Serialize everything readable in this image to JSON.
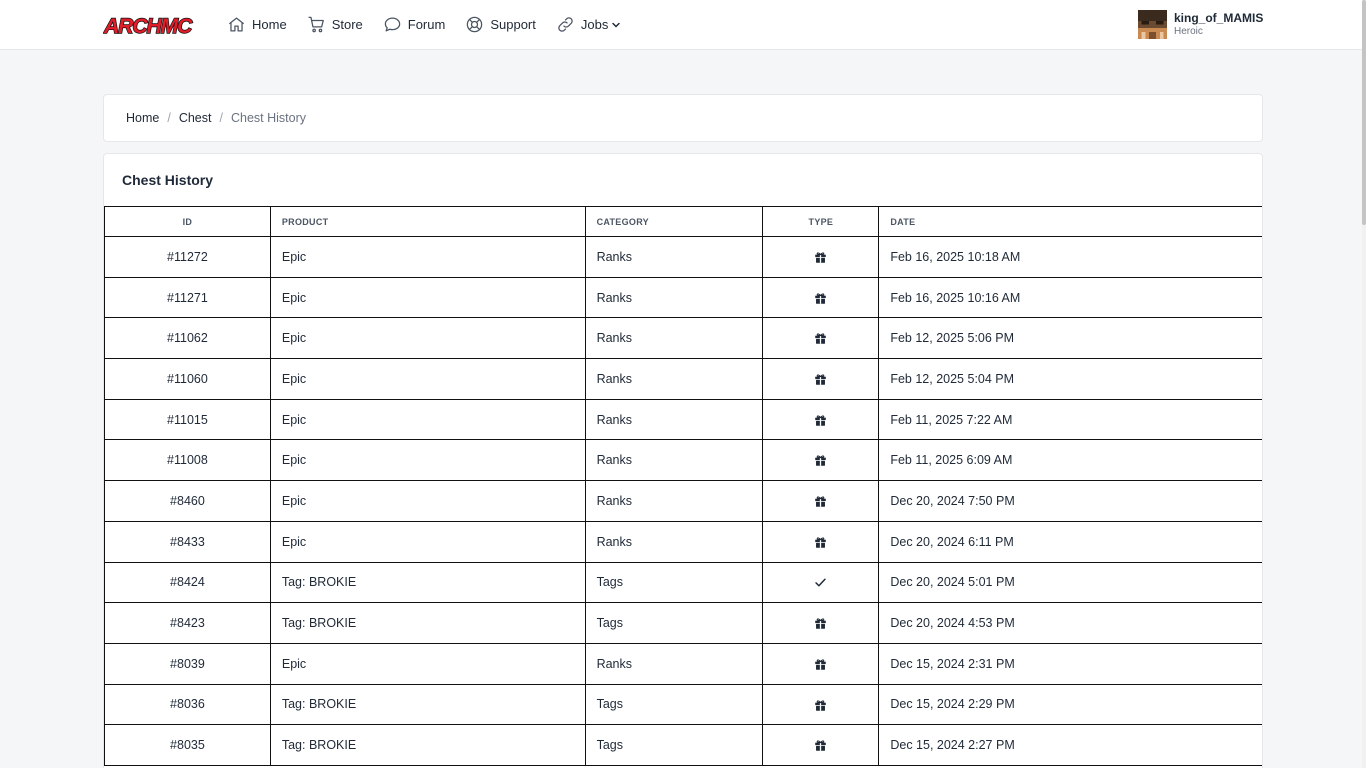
{
  "nav": {
    "logo_text": "ARCHMC",
    "items": [
      {
        "label": "Home",
        "icon": "home-icon"
      },
      {
        "label": "Store",
        "icon": "cart-icon"
      },
      {
        "label": "Forum",
        "icon": "chat-icon"
      },
      {
        "label": "Support",
        "icon": "lifebuoy-icon"
      },
      {
        "label": "Jobs",
        "icon": "link-icon"
      }
    ]
  },
  "user": {
    "name": "king_of_MAMIS",
    "rank": "Heroic"
  },
  "breadcrumb": {
    "home": "Home",
    "chest": "Chest",
    "current": "Chest History"
  },
  "card": {
    "title": "Chest History"
  },
  "table": {
    "headers": {
      "id": "ID",
      "product": "PRODUCT",
      "category": "CATEGORY",
      "type": "TYPE",
      "date": "DATE"
    },
    "rows": [
      {
        "id": "#11272",
        "product": "Epic",
        "category": "Ranks",
        "type": "gift-icon",
        "date": "Feb 16, 2025 10:18 AM"
      },
      {
        "id": "#11271",
        "product": "Epic",
        "category": "Ranks",
        "type": "gift-icon",
        "date": "Feb 16, 2025 10:16 AM"
      },
      {
        "id": "#11062",
        "product": "Epic",
        "category": "Ranks",
        "type": "gift-icon",
        "date": "Feb 12, 2025 5:06 PM"
      },
      {
        "id": "#11060",
        "product": "Epic",
        "category": "Ranks",
        "type": "gift-icon",
        "date": "Feb 12, 2025 5:04 PM"
      },
      {
        "id": "#11015",
        "product": "Epic",
        "category": "Ranks",
        "type": "gift-icon",
        "date": "Feb 11, 2025 7:22 AM"
      },
      {
        "id": "#11008",
        "product": "Epic",
        "category": "Ranks",
        "type": "gift-icon",
        "date": "Feb 11, 2025 6:09 AM"
      },
      {
        "id": "#8460",
        "product": "Epic",
        "category": "Ranks",
        "type": "gift-icon",
        "date": "Dec 20, 2024 7:50 PM"
      },
      {
        "id": "#8433",
        "product": "Epic",
        "category": "Ranks",
        "type": "gift-icon",
        "date": "Dec 20, 2024 6:11 PM"
      },
      {
        "id": "#8424",
        "product": "Tag: BROKIE",
        "category": "Tags",
        "type": "check-icon",
        "date": "Dec 20, 2024 5:01 PM"
      },
      {
        "id": "#8423",
        "product": "Tag: BROKIE",
        "category": "Tags",
        "type": "gift-icon",
        "date": "Dec 20, 2024 4:53 PM"
      },
      {
        "id": "#8039",
        "product": "Epic",
        "category": "Ranks",
        "type": "gift-icon",
        "date": "Dec 15, 2024 2:31 PM"
      },
      {
        "id": "#8036",
        "product": "Tag: BROKIE",
        "category": "Tags",
        "type": "gift-icon",
        "date": "Dec 15, 2024 2:29 PM"
      },
      {
        "id": "#8035",
        "product": "Tag: BROKIE",
        "category": "Tags",
        "type": "gift-icon",
        "date": "Dec 15, 2024 2:27 PM"
      }
    ]
  },
  "colors": {
    "accent": "#e11d2a",
    "text": "#1f2937",
    "muted": "#6b7280",
    "background": "#f4f6f8"
  }
}
